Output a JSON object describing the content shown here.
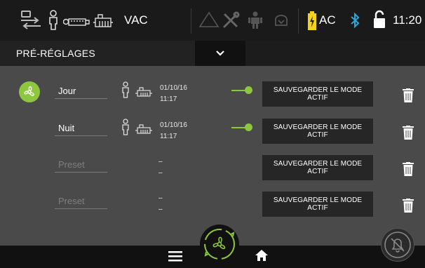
{
  "header": {
    "mode_label": "VAC",
    "power_label": "AC",
    "time": "11:20"
  },
  "subheader": {
    "title": "PRÉ-RÉGLAGES"
  },
  "presets": [
    {
      "name": "Jour",
      "is_placeholder": false,
      "date": "01/10/16",
      "time": "11:17",
      "save_label": "SAUVEGARDER LE MODE ACTIF",
      "active": true
    },
    {
      "name": "Nuit",
      "is_placeholder": false,
      "date": "01/10/16",
      "time": "11:17",
      "save_label": "SAUVEGARDER LE MODE ACTIF",
      "active": true
    },
    {
      "name": "Preset",
      "is_placeholder": true,
      "date": "–",
      "time": "–",
      "save_label": "SAUVEGARDER LE MODE ACTIF",
      "active": false
    },
    {
      "name": "Preset",
      "is_placeholder": true,
      "date": "–",
      "time": "–",
      "save_label": "SAUVEGARDER LE MODE ACTIF",
      "active": false
    }
  ],
  "colors": {
    "accent": "#8dc63f",
    "bluetooth": "#29a8e0",
    "battery": "#f2d21b"
  },
  "icons": {
    "left_group": [
      "air-exchange-icon",
      "person-icon",
      "duct-unit-icon",
      "heat-unit-icon"
    ],
    "middle_group": [
      "warning-icon",
      "tools-icon",
      "occupant-icon",
      "comfort-icon"
    ],
    "right_group": [
      "battery-icon",
      "bluetooth-icon",
      "lock-icon"
    ]
  }
}
